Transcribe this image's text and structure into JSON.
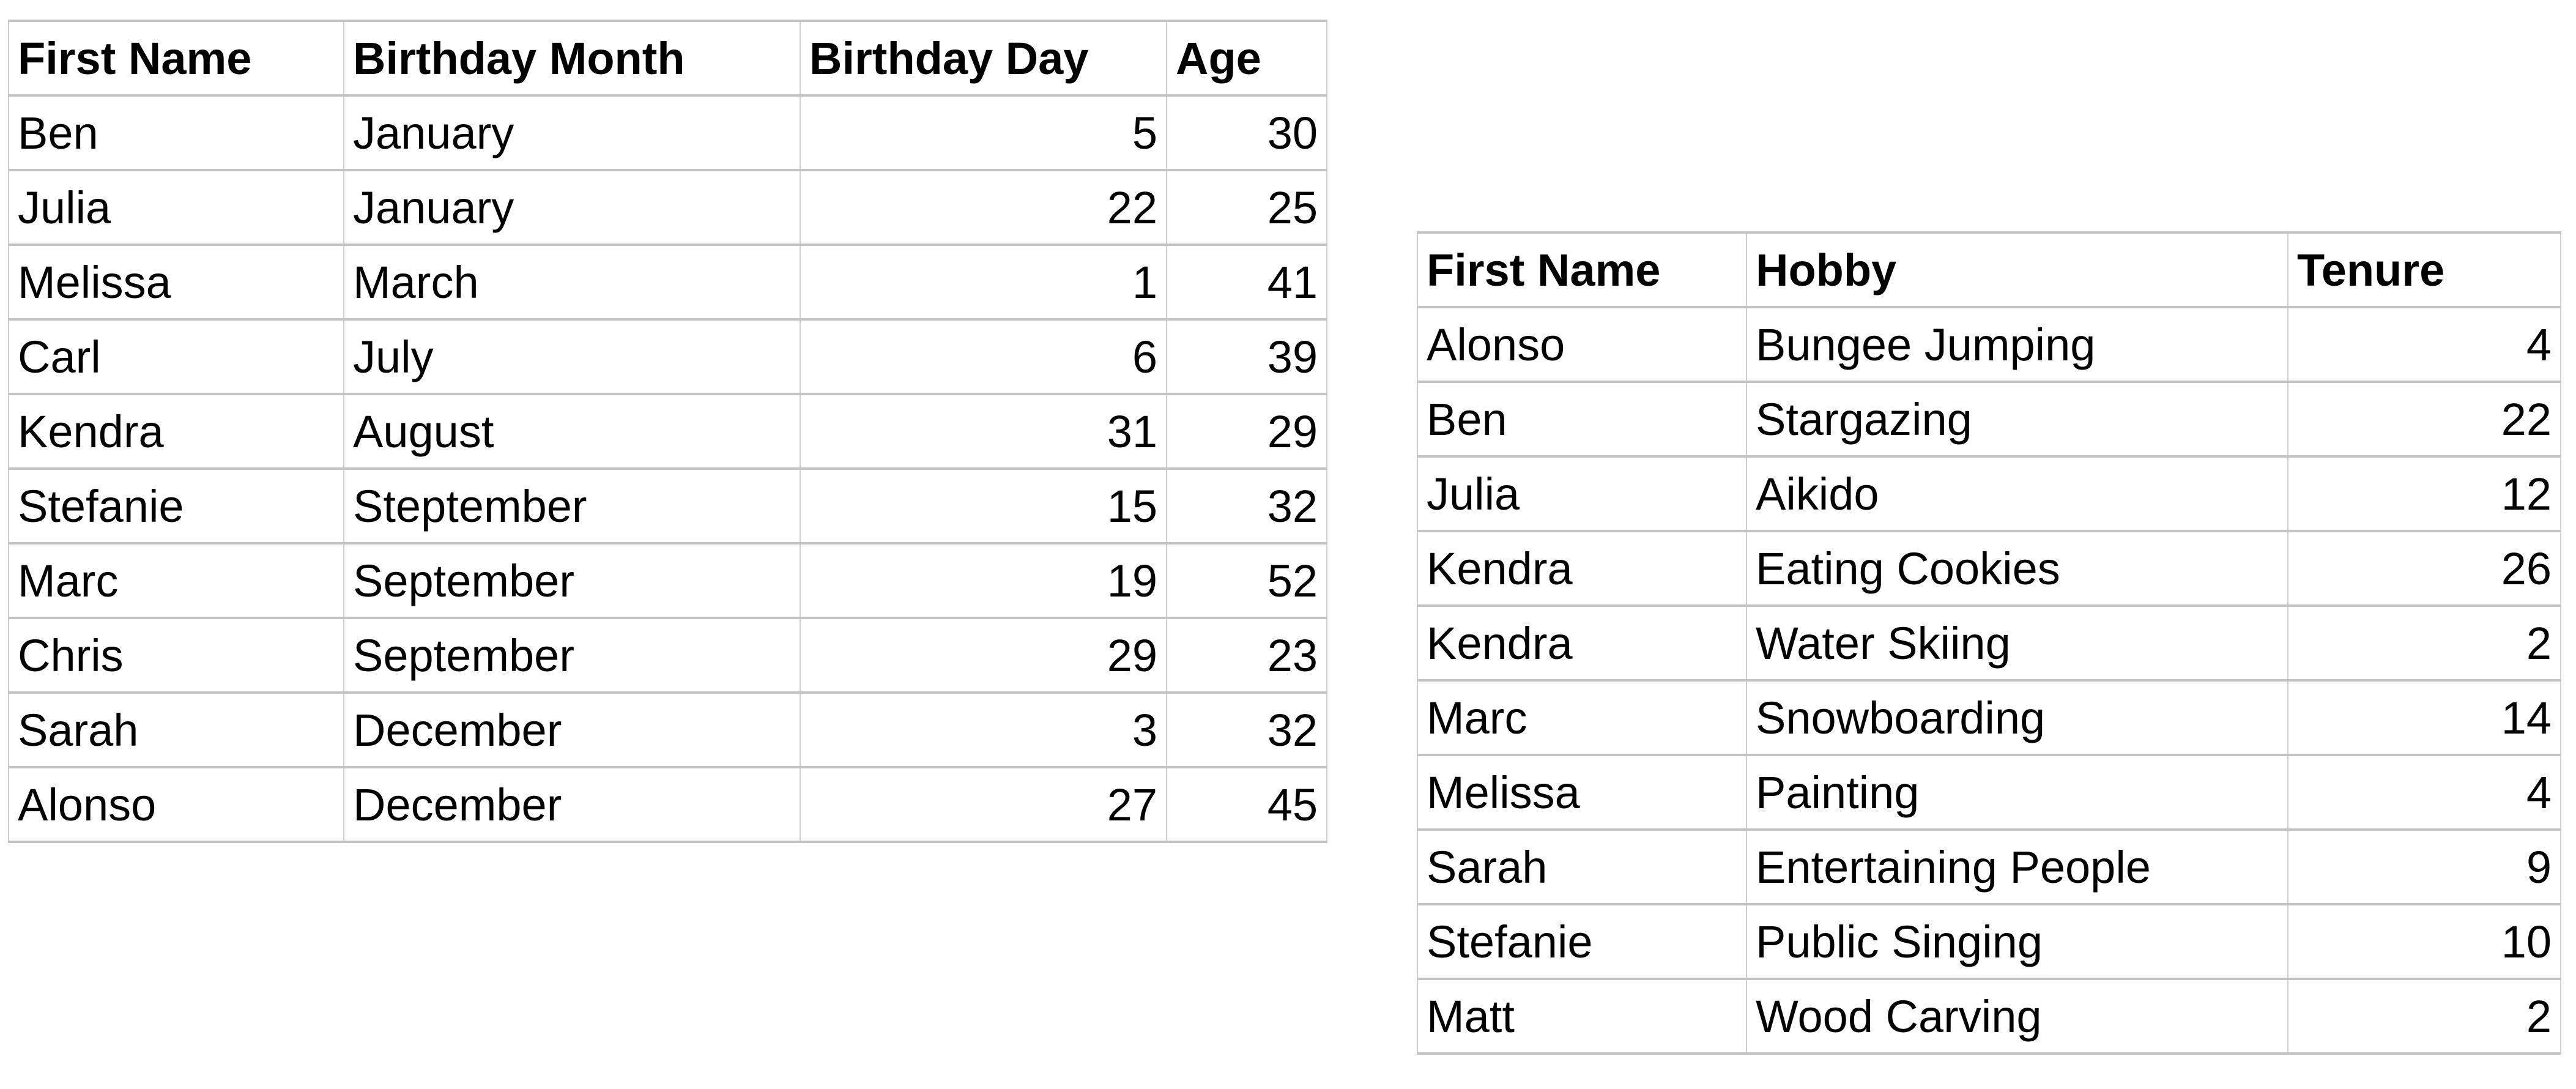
{
  "birthday_table": {
    "headers": [
      "First Name",
      "Birthday Month",
      "Birthday Day",
      "Age"
    ],
    "rows": [
      [
        "Ben",
        "January",
        "5",
        "30"
      ],
      [
        "Julia",
        "January",
        "22",
        "25"
      ],
      [
        "Melissa",
        "March",
        "1",
        "41"
      ],
      [
        "Carl",
        "July",
        "6",
        "39"
      ],
      [
        "Kendra",
        "August",
        "31",
        "29"
      ],
      [
        "Stefanie",
        "Steptember",
        "15",
        "32"
      ],
      [
        "Marc",
        "September",
        "19",
        "52"
      ],
      [
        "Chris",
        "September",
        "29",
        "23"
      ],
      [
        "Sarah",
        "December",
        "3",
        "32"
      ],
      [
        "Alonso",
        "December",
        "27",
        "45"
      ]
    ]
  },
  "hobby_table": {
    "headers": [
      "First Name",
      "Hobby",
      "Tenure"
    ],
    "rows": [
      [
        "Alonso",
        "Bungee Jumping",
        "4"
      ],
      [
        "Ben",
        "Stargazing",
        "22"
      ],
      [
        "Julia",
        "Aikido",
        "12"
      ],
      [
        "Kendra",
        "Eating Cookies",
        "26"
      ],
      [
        "Kendra",
        "Water Skiing",
        "2"
      ],
      [
        "Marc",
        "Snowboarding",
        "14"
      ],
      [
        "Melissa",
        "Painting",
        "4"
      ],
      [
        "Sarah",
        "Entertaining People",
        "9"
      ],
      [
        "Stefanie",
        "Public Singing",
        "10"
      ],
      [
        "Matt",
        "Wood Carving",
        "2"
      ]
    ]
  }
}
